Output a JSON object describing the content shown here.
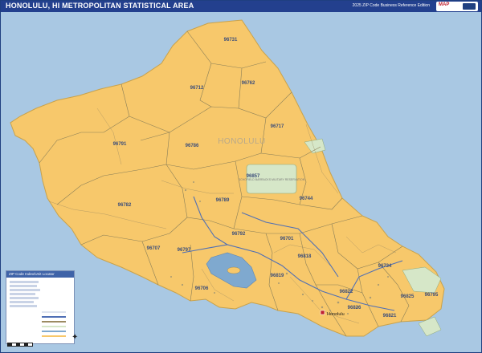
{
  "header": {
    "title": "HONOLULU, HI METROPOLITAN STATISTICAL AREA",
    "edition": "2025 ZIP Code Business Reference Edition"
  },
  "map": {
    "county_label": "HONOLULU",
    "reserve_label": "SCHOFIELD BARRACKS MILITARY RESERVATION",
    "capital_label": "Honolulu",
    "colors": {
      "ocean": "#a9c8e3",
      "land": "#f7c86b",
      "boundary": "#8a7f58",
      "road": "#4f6fb5",
      "park": "#d6e7c8",
      "water": "#7fa9cf"
    },
    "zip_labels": [
      "96731",
      "96762",
      "96712",
      "96717",
      "96791",
      "96786",
      "96857",
      "96744",
      "96782",
      "96789",
      "96792",
      "96707",
      "96797",
      "96701",
      "96818",
      "96734",
      "96706",
      "96819",
      "96822",
      "96795",
      "96825",
      "96821",
      "96826"
    ]
  },
  "legend": {
    "heading": "ZIP Code Index/Unit Locator"
  }
}
